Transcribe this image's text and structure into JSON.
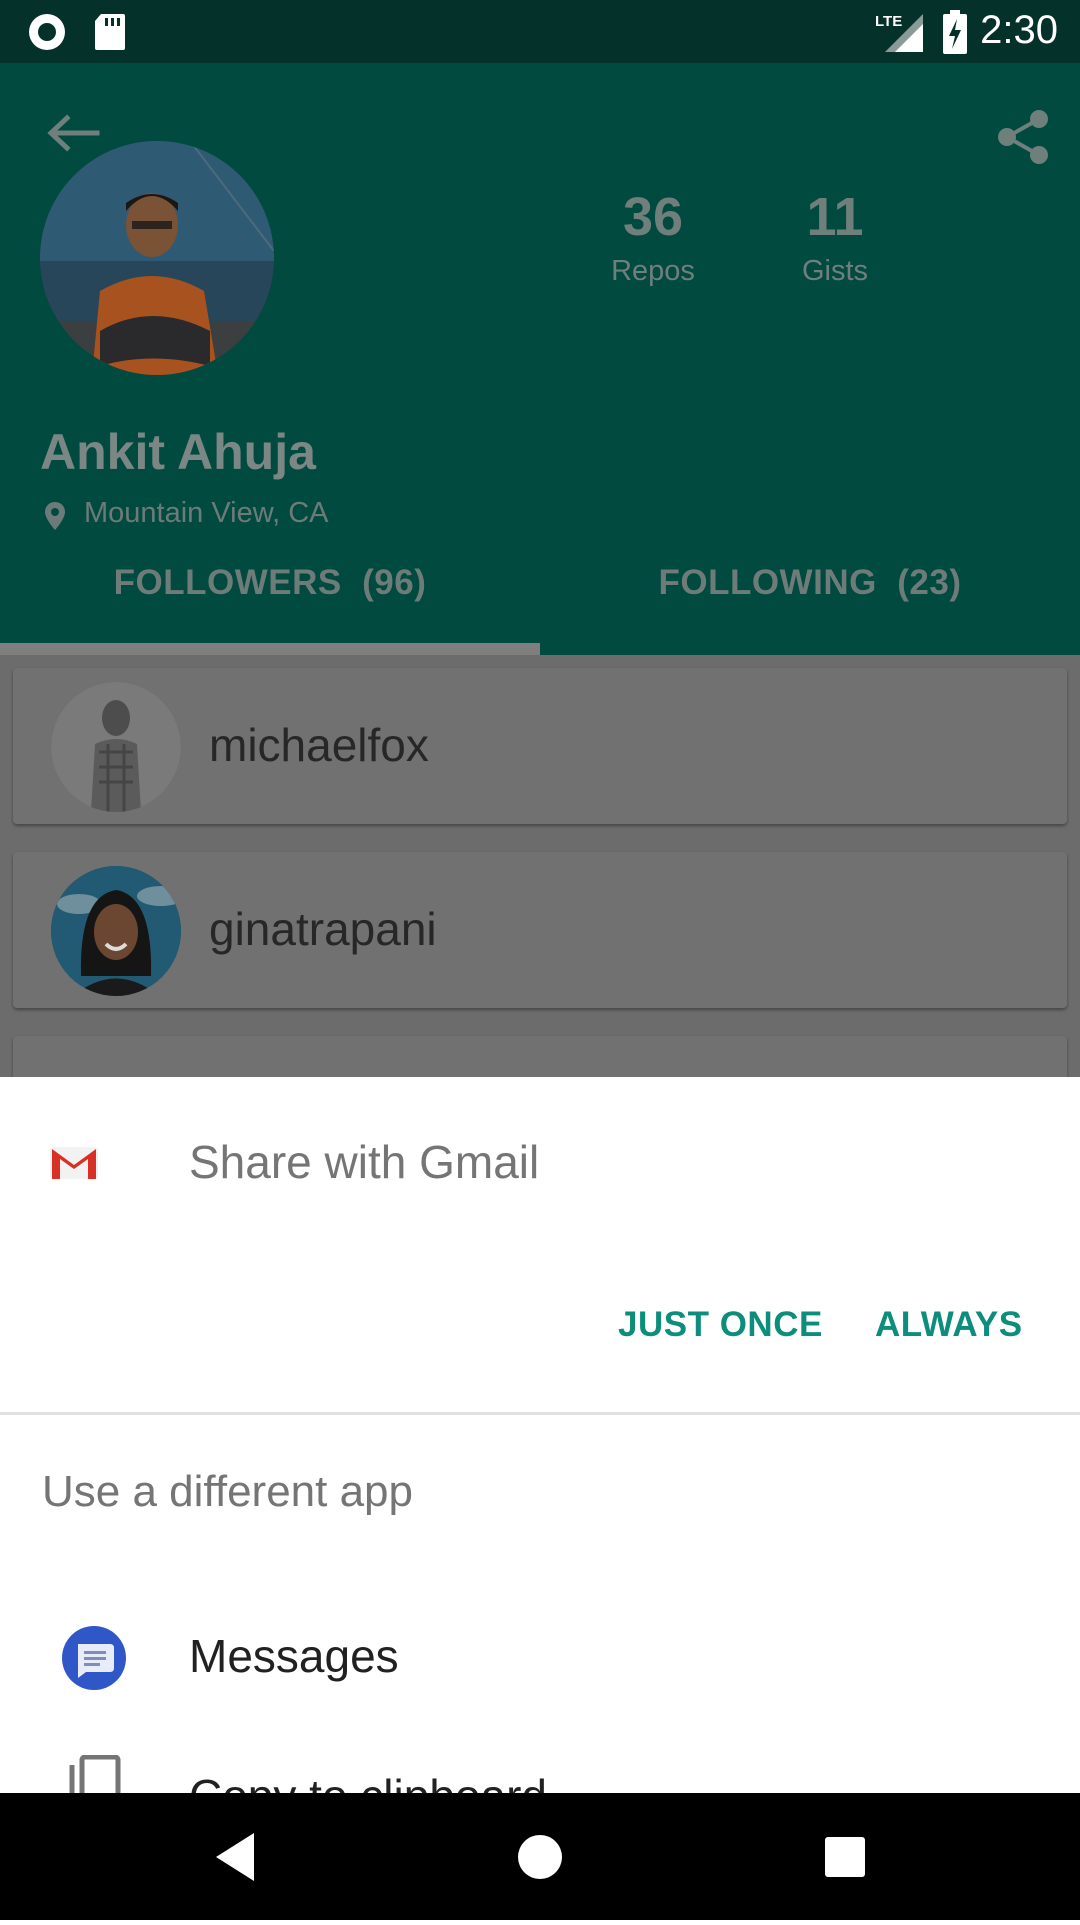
{
  "status_bar": {
    "time": "2:30",
    "network": "LTE",
    "icons": [
      "record-icon",
      "sd-card-icon",
      "lte-signal-icon",
      "battery-charging-icon"
    ]
  },
  "profile": {
    "name": "Ankit Ahuja",
    "location": "Mountain View, CA",
    "stats": [
      {
        "value": "36",
        "label": "Repos"
      },
      {
        "value": "11",
        "label": "Gists"
      }
    ],
    "tabs": [
      {
        "label": "FOLLOWERS  (96)",
        "selected": true
      },
      {
        "label": "FOLLOWING  (23)",
        "selected": false
      }
    ]
  },
  "list": {
    "items": [
      {
        "username": "michaelfox"
      },
      {
        "username": "ginatrapani"
      }
    ]
  },
  "share_sheet": {
    "title": "Share with Gmail",
    "buttons": {
      "just_once": "JUST ONCE",
      "always": "ALWAYS"
    },
    "different_app_label": "Use a different app",
    "apps": [
      {
        "label": "Messages",
        "icon": "messages-icon"
      },
      {
        "label": "Copy to clipboard",
        "icon": "clipboard-icon"
      }
    ]
  },
  "colors": {
    "header_dimmed": "#004a40",
    "accent": "#0d8d7c",
    "status_bar": "#05312b"
  }
}
